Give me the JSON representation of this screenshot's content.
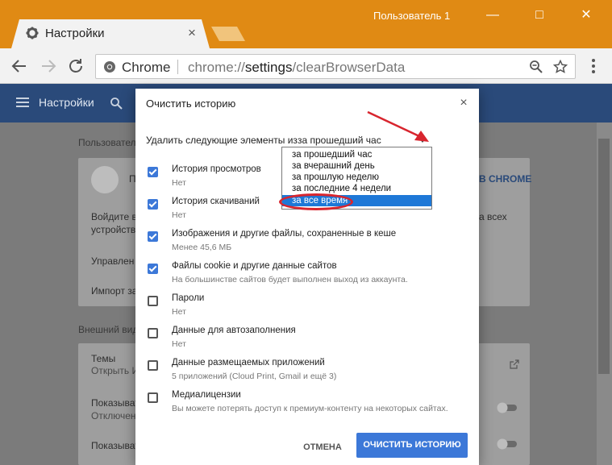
{
  "window": {
    "tab_title": "Настройки",
    "user_label": "Пользователь 1",
    "tab_close": "×",
    "minimize": "—",
    "maximize": "□",
    "close": "✕"
  },
  "omnibox": {
    "site_chip": "Chrome",
    "url_host": "chrome://",
    "url_path_bold": "settings",
    "url_rest": "/clearBrowserData"
  },
  "settings_header": {
    "title": "Настройки"
  },
  "background": {
    "section_people": "Пользовател",
    "people_card_name": "П",
    "people_card_link": "В CHROME",
    "signin_line1": "Войдите в",
    "signin_line1_right": "а всех",
    "signin_line2": "устройства",
    "manage_row": "Управлен",
    "import_row": "Импорт за",
    "section_appearance": "Внешний вид",
    "themes_row": "Темы",
    "themes_sub": "Открыть И",
    "show_row1": "Показыват",
    "show_row1_sub": "Отключен",
    "show_row2": "Показыват"
  },
  "dialog": {
    "title": "Очистить историю",
    "close": "×",
    "range_label": "Удалить следующие элементы из",
    "range_selected": "за прошедший час",
    "range_options": [
      "за прошедший час",
      "за вчерашний день",
      "за прошлую неделю",
      "за последние 4 недели",
      "за все время"
    ],
    "highlighted_option": "за все время",
    "options": [
      {
        "title": "История просмотров",
        "sub": "Нет",
        "checked": true
      },
      {
        "title": "История скачиваний",
        "sub": "Нет",
        "checked": true
      },
      {
        "title": "Изображения и другие файлы, сохраненные в кеше",
        "sub": "Менее 45,6 МБ",
        "checked": true
      },
      {
        "title": "Файлы cookie и другие данные сайтов",
        "sub": "На большинстве сайтов будет выполнен выход из аккаунта.",
        "checked": true
      },
      {
        "title": "Пароли",
        "sub": "Нет",
        "checked": false
      },
      {
        "title": "Данные для автозаполнения",
        "sub": "Нет",
        "checked": false
      },
      {
        "title": "Данные размещаемых приложений",
        "sub": "5 приложений (Cloud Print, Gmail и ещё 3)",
        "checked": false
      },
      {
        "title": "Медиалицензии",
        "sub": "Вы можете потерять доступ к премиум-контенту на некоторых сайтах.",
        "checked": false
      }
    ],
    "cancel_label": "ОТМЕНА",
    "clear_label": "ОЧИСТИТЬ ИСТОРИЮ"
  },
  "colors": {
    "title_bar": "#e08a14",
    "settings_bar": "#2a4a7a",
    "accent": "#3c78d8",
    "annotation": "#d8252e"
  },
  "icons": {
    "tab": "gear-icon",
    "back": "back-arrow-icon",
    "forward": "forward-arrow-icon",
    "reload": "reload-icon",
    "site": "chrome-logo-icon",
    "zoom": "zoom-icon",
    "bookmark": "star-icon",
    "menu": "more-vert-icon"
  }
}
